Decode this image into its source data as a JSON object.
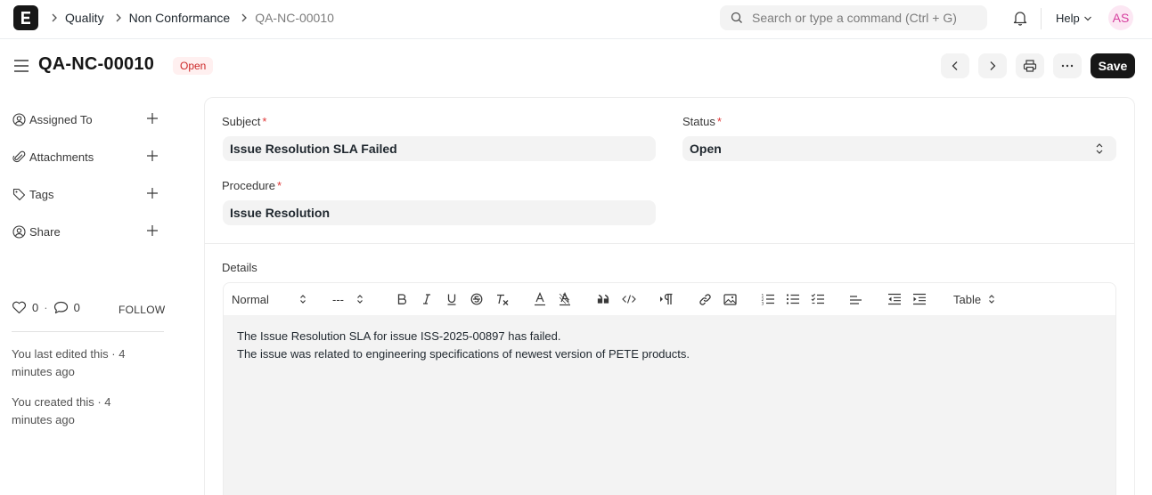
{
  "navbar": {
    "logo_letter": "E",
    "breadcrumbs": [
      "Quality",
      "Non Conformance",
      "QA-NC-00010"
    ],
    "search_placeholder": "Search or type a command (Ctrl + G)",
    "help_label": "Help",
    "avatar_initials": "AS"
  },
  "page": {
    "title": "QA-NC-00010",
    "status": "Open",
    "save_label": "Save"
  },
  "sidebar": {
    "items": [
      {
        "label": "Assigned To",
        "icon": "user-assign-icon"
      },
      {
        "label": "Attachments",
        "icon": "paperclip-icon"
      },
      {
        "label": "Tags",
        "icon": "tag-icon"
      },
      {
        "label": "Share",
        "icon": "share-user-icon"
      }
    ],
    "likes_count": "0",
    "comments_count": "0",
    "follow_label": "FOLLOW",
    "activity": [
      "You last edited this · 4 minutes ago",
      "You created this · 4 minutes ago"
    ]
  },
  "form": {
    "subject_label": "Subject",
    "subject_value": "Issue Resolution SLA Failed",
    "status_label": "Status",
    "status_value": "Open",
    "procedure_label": "Procedure",
    "procedure_value": "Issue Resolution",
    "details_label": "Details",
    "toolbar": {
      "format": "Normal",
      "size": "---",
      "table": "Table"
    },
    "details_lines": [
      "The Issue Resolution SLA for issue ISS-2025-00897 has failed.",
      "The issue was related to engineering specifications of newest version of PETE products."
    ]
  },
  "colors": {
    "brand": "#171717",
    "status_open_bg": "#fff0f0",
    "status_open_text": "#cc2929",
    "avatar_bg": "#fce7f3",
    "avatar_text": "#d6409f",
    "input_bg": "#f3f3f3"
  }
}
